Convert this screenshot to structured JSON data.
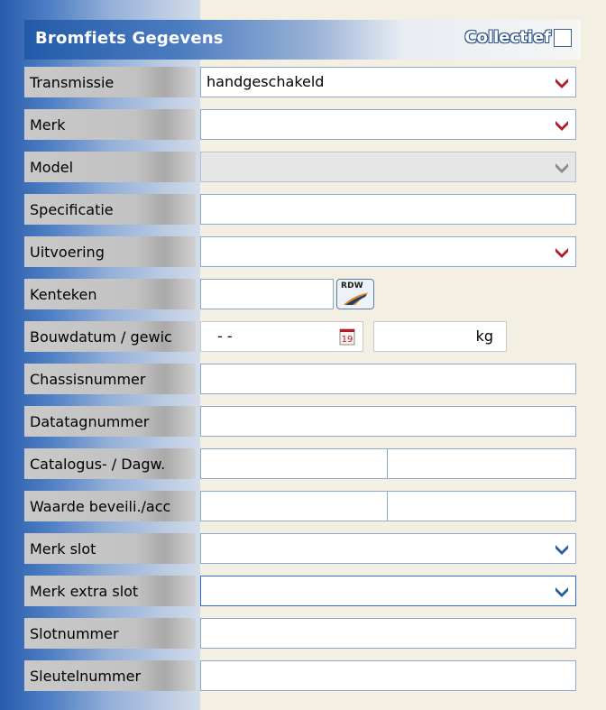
{
  "header": {
    "title": "Bromfiets Gegevens",
    "collectief_label": "Collectief",
    "collectief_checked": false
  },
  "rows": [
    {
      "label": "Transmissie",
      "value": "handgeschakeld",
      "type": "select",
      "chevron_color": "#b01c2e"
    },
    {
      "label": "Merk",
      "value": "",
      "type": "select",
      "chevron_color": "#b01c2e"
    },
    {
      "label": "Model",
      "value": "",
      "type": "select-disabled",
      "chevron_color": "#8a8a8a"
    },
    {
      "label": "Specificatie",
      "value": "",
      "type": "text"
    },
    {
      "label": "Uitvoering",
      "value": "",
      "type": "select",
      "chevron_color": "#b01c2e"
    },
    {
      "label": "Kenteken",
      "value": "",
      "type": "text-rdw",
      "button_label": "RDW"
    },
    {
      "label": "Bouwdatum / gewic",
      "date_value": "- -",
      "weight_value": "",
      "unit": "kg",
      "calendar_label": "19",
      "type": "date-weight"
    },
    {
      "label": "Chassisnummer",
      "value": "",
      "type": "text"
    },
    {
      "label": "Datatagnummer",
      "value": "",
      "type": "text"
    },
    {
      "label": "Catalogus- / Dagw.",
      "value_left": "",
      "value_right": "",
      "type": "split"
    },
    {
      "label": "Waarde beveili./acc",
      "value_left": "",
      "value_right": "",
      "type": "split"
    },
    {
      "label": "Merk slot",
      "value": "",
      "type": "select",
      "chevron_color": "#2a5d9c"
    },
    {
      "label": "Merk extra slot",
      "value": "",
      "type": "select-focused",
      "chevron_color": "#2a5d9c"
    },
    {
      "label": "Slotnummer",
      "value": "",
      "type": "text"
    },
    {
      "label": "Sleutelnummer",
      "value": "",
      "type": "text"
    }
  ],
  "colors": {
    "accent_blue": "#2a5cae",
    "chevron_red": "#b01c2e",
    "chevron_blue": "#2a5d9c",
    "panel_bg": "#f3efe3"
  },
  "icons": {
    "chevron": "chevron-down-icon",
    "calendar": "calendar-icon",
    "rdw": "rdw-lookup-icon",
    "checkbox": "checkbox-icon"
  }
}
